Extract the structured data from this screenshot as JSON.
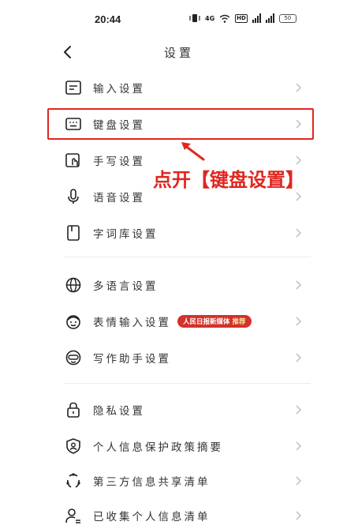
{
  "status_bar": {
    "time": "20:44",
    "network_label": "4G",
    "hd_label": "HD",
    "battery": "50"
  },
  "header": {
    "title": "设置"
  },
  "settings": [
    {
      "label": "输入设置",
      "icon": "input-settings-icon"
    },
    {
      "label": "键盘设置",
      "icon": "keyboard-icon"
    },
    {
      "label": "手写设置",
      "icon": "handwriting-icon"
    },
    {
      "label": "语音设置",
      "icon": "microphone-icon"
    },
    {
      "label": "字词库设置",
      "icon": "dictionary-icon"
    },
    {
      "label": "多语言设置",
      "icon": "globe-icon"
    },
    {
      "label": "表情输入设置",
      "icon": "emoji-face-icon",
      "badge": "人民日报新媒体",
      "badge_hot": "推荐"
    },
    {
      "label": "写作助手设置",
      "icon": "mask-icon"
    },
    {
      "label": "隐私设置",
      "icon": "lock-icon"
    },
    {
      "label": "个人信息保护政策摘要",
      "icon": "shield-person-icon"
    },
    {
      "label": "第三方信息共享清单",
      "icon": "share-cycle-icon"
    },
    {
      "label": "已收集个人信息清单",
      "icon": "user-list-icon"
    }
  ],
  "annotation": {
    "text": "点开【键盘设置】",
    "color": "#e0261f"
  }
}
